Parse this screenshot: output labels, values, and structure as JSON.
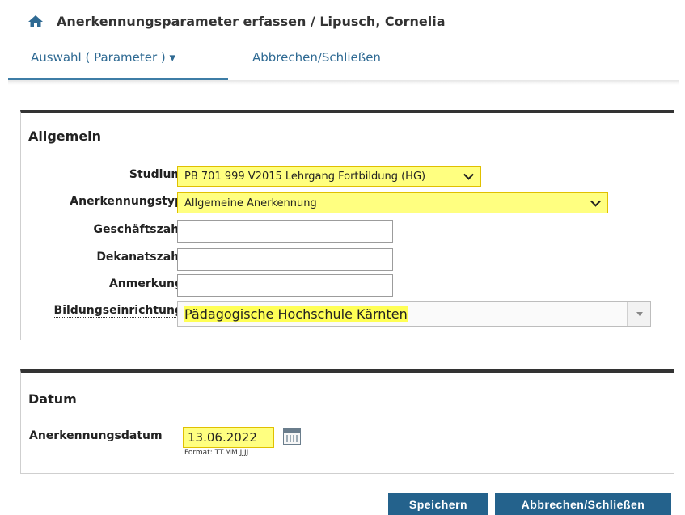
{
  "header": {
    "title": "Anerkennungsparameter erfassen  / Lipusch, Cornelia",
    "home_icon": "home-icon"
  },
  "tabs": {
    "selection_label": "Auswahl ( Parameter ) ▾",
    "cancel_label": "Abbrechen/Schließen"
  },
  "allgemein": {
    "title": "Allgemein",
    "studium_label": "Studium",
    "studium_value": "PB 701 999 V2015 Lehrgang Fortbildung (HG)",
    "anerkennungstyp_label": "Anerkennungstyp",
    "anerkennungstyp_value": "Allgemeine Anerkennung",
    "geschaeftszahl_label": "Geschäftszahl",
    "geschaeftszahl_value": "",
    "dekanatszahl_label": "Dekanatszahl",
    "dekanatszahl_value": "",
    "anmerkung_label": "Anmerkung",
    "anmerkung_value": "",
    "bildungseinrichtung_label": "Bildungseinrichtung",
    "bildungseinrichtung_value": "Pädagogische Hochschule Kärnten"
  },
  "datum": {
    "title": "Datum",
    "anerkennungsdatum_label": "Anerkennungsdatum",
    "anerkennungsdatum_value": "13.06.2022",
    "format_hint": "Format: TT.MM.JJJJ"
  },
  "buttons": {
    "save": "Speichern",
    "cancel": "Abbrechen/Schließen"
  },
  "colors": {
    "accent": "#24628c",
    "tab_text": "#2f6a93",
    "highlight": "#ffff80"
  }
}
